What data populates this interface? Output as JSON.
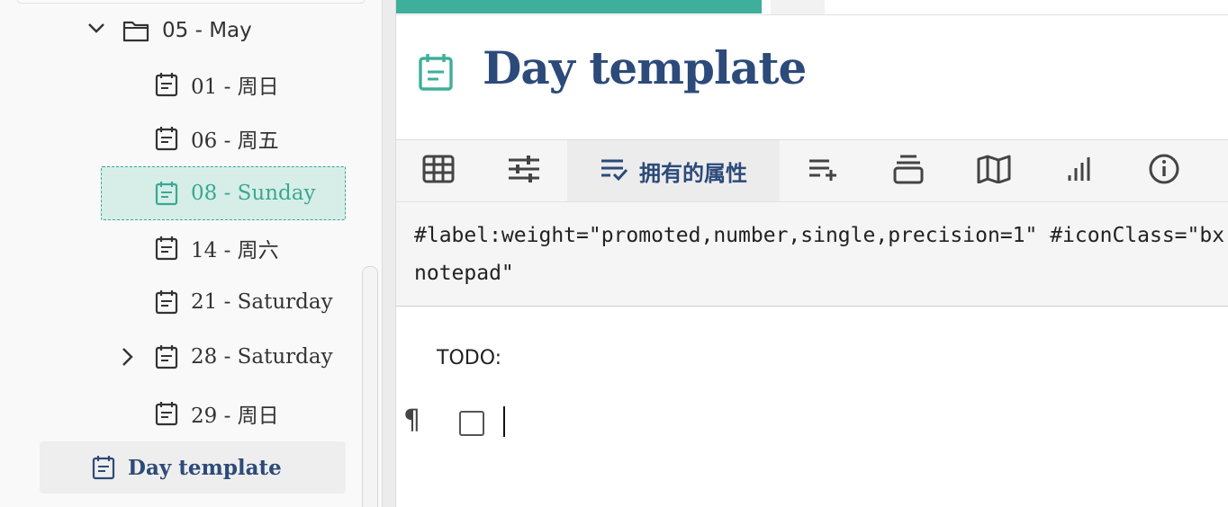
{
  "tree": {
    "folder": {
      "label": "05 - May",
      "icon": "folder-icon",
      "expanded": true
    },
    "items": [
      {
        "label": "01 - 周日",
        "icon": "note-icon"
      },
      {
        "label": "06 - 周五",
        "icon": "note-icon"
      },
      {
        "label": "08 - Sunday",
        "icon": "note-icon",
        "state": "active"
      },
      {
        "label": "14 - 周六",
        "icon": "note-icon"
      },
      {
        "label": "21 - Saturday",
        "icon": "note-icon"
      },
      {
        "label": "28 - Saturday",
        "icon": "note-icon",
        "has_children": true
      },
      {
        "label": "29 - 周日",
        "icon": "note-icon"
      }
    ],
    "current": {
      "label": "Day template",
      "icon": "note-icon"
    }
  },
  "note": {
    "title": "Day template",
    "title_icon": "calendar-note-icon",
    "ribbon": {
      "tabs": [
        {
          "name": "table-icon"
        },
        {
          "name": "sliders-icon"
        },
        {
          "name": "owned-attributes-icon",
          "label": "拥有的属性",
          "active": true
        },
        {
          "name": "add-list-icon"
        },
        {
          "name": "stack-icon"
        },
        {
          "name": "map-icon"
        },
        {
          "name": "bar-chart-icon"
        },
        {
          "name": "info-icon"
        }
      ]
    },
    "attributes_text": "#label:weight=\"promoted,number,single,precision=1\" #iconClass=\"bx bx-\nnotepad\"",
    "content": {
      "heading": "TODO:",
      "paragraph_mark": "¶"
    }
  },
  "colors": {
    "accent": "#3eaf9a",
    "title": "#2c4a7a",
    "active_bg": "#d7eee8"
  }
}
